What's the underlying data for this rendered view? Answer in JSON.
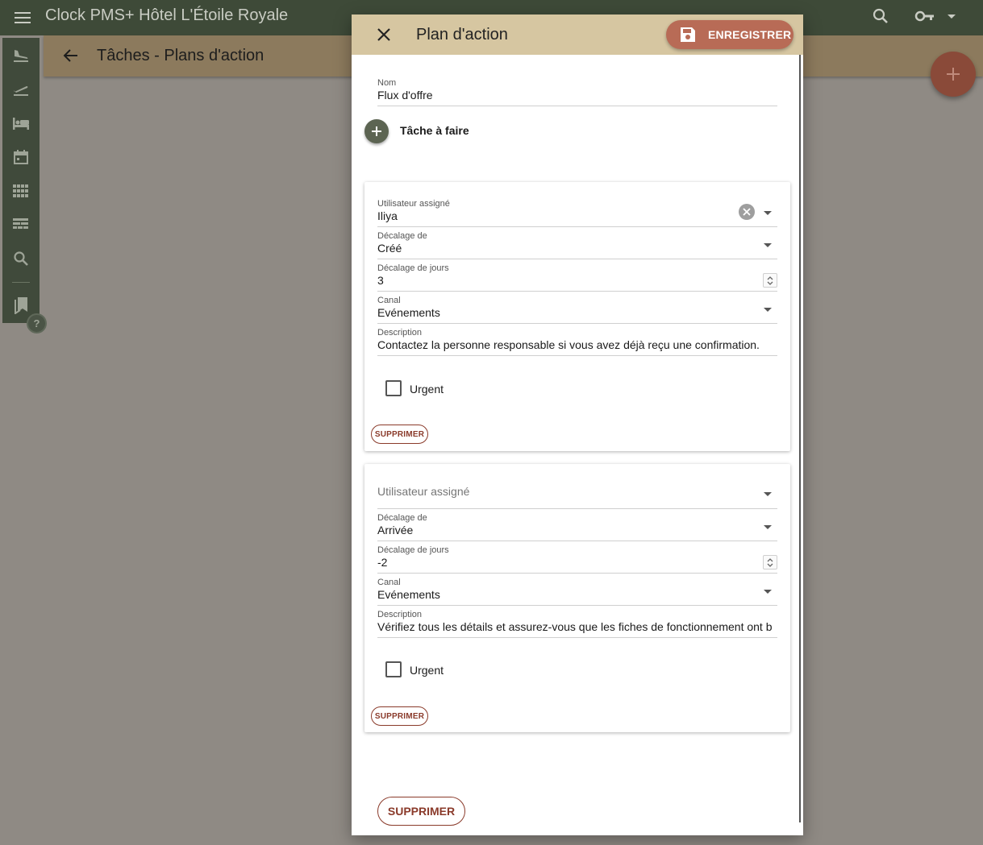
{
  "app": {
    "title": "Clock PMS+   Hôtel L'Étoile Royale"
  },
  "page": {
    "title": "Tâches - Plans d'action"
  },
  "nav": {
    "items": [
      "arrivals-icon",
      "departures-icon",
      "rooms-icon",
      "calendar-icon",
      "grid-icon",
      "table-icon",
      "search-icon",
      "bookmarks-icon"
    ]
  },
  "dialog": {
    "title": "Plan d'action",
    "save_label": "ENREGISTRER",
    "name_label": "Nom",
    "name_value": "Flux d'offre",
    "add_task_label": "Tâche à faire",
    "delete_label": "SUPPRIMER",
    "tasks": [
      {
        "user_label": "Utilisateur assigné",
        "user_value": "Iliya",
        "offset_label": "Décalage de",
        "offset_value": "Créé",
        "days_label": "Décalage de jours",
        "days_value": "3",
        "channel_label": "Canal",
        "channel_value": "Evénements",
        "description_label": "Description",
        "description_value": "Contactez la personne responsable si vous avez déjà reçu une confirmation.",
        "urgent_label": "Urgent",
        "urgent_checked": false,
        "delete_label": "SUPPRIMER"
      },
      {
        "user_placeholder": "Utilisateur assigné",
        "offset_label": "Décalage de",
        "offset_value": "Arrivée",
        "days_label": "Décalage de jours",
        "days_value": "-2",
        "channel_label": "Canal",
        "channel_value": "Evénements",
        "description_label": "Description",
        "description_value": "Vérifiez tous les détails et assurez-vous que les fiches de fonctionnement ont b",
        "urgent_label": "Urgent",
        "urgent_checked": false,
        "delete_label": "SUPPRIMER"
      }
    ]
  },
  "help_label": "?",
  "colors": {
    "appbar": "#3e4a38",
    "subheader": "#8c7a5d",
    "dialog_header": "#d6c6a1",
    "save_button": "#b86b56",
    "fab": "#8a4a39",
    "danger": "#8a3a2a"
  }
}
